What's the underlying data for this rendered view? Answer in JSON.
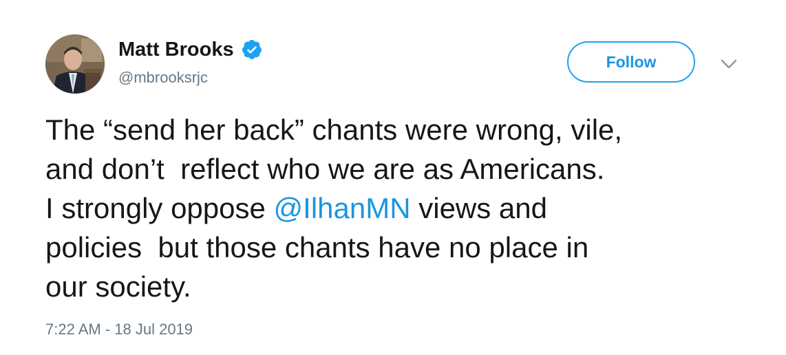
{
  "user": {
    "display_name": "Matt Brooks",
    "handle": "@mbrooksrjc",
    "verified": true
  },
  "follow_button": {
    "label": "Follow"
  },
  "menu": {
    "icon": "chevron-down-icon"
  },
  "tweet": {
    "line1": "The “send her back” chants were wrong, vile,",
    "line2": "and don’t  reflect who we are as Americans.",
    "line3_prefix": "I strongly oppose ",
    "mention": "@IlhanMN",
    "line3_suffix": " views and",
    "line4": "policies  but those chants have no place in",
    "line5": "our society."
  },
  "timestamp": "7:22 AM - 18 Jul 2019",
  "colors": {
    "accent": "#1da1f2",
    "link": "#1b95e0",
    "text": "#14171a",
    "secondary": "#657786"
  }
}
